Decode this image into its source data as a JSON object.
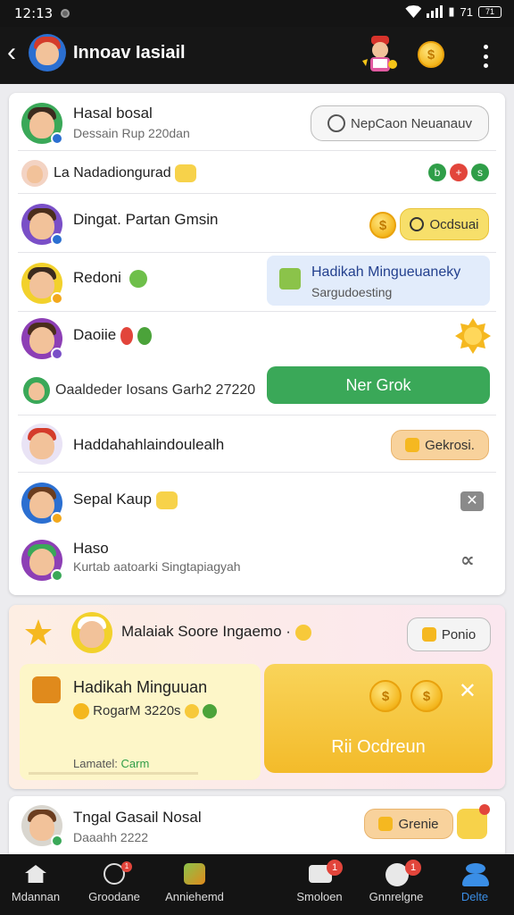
{
  "status": {
    "time": "12:13",
    "battery": "71",
    "signal": "71"
  },
  "header": {
    "title": "Innoav Iasiail"
  },
  "list": [
    {
      "name": "Hasal bosal",
      "sub": "Dessain Rup 220dan",
      "action": "NepCaon Neuanauv"
    },
    {
      "name": "La Nadadiongurad",
      "icons": [
        "b",
        "+",
        "s"
      ]
    },
    {
      "name": "Dingat. Partan Gmsin",
      "action": "Ocdsuai"
    },
    {
      "name": "Redoni",
      "popup_title": "Hadikah Mingueuaneky",
      "popup_sub": "Sargudoesting"
    },
    {
      "name": "Daoiie"
    },
    {
      "name": "Oaaldeder Iosans Garh2 27220",
      "action": "Ner Grok"
    },
    {
      "name": "Haddahahlaindoulealh",
      "action": "Gekrosi."
    },
    {
      "name": "Sepal Kaup"
    },
    {
      "name": "Haso",
      "sub": "Kurtab aatoarki Singtapiagyah"
    }
  ],
  "promo": {
    "title": "Malaiak Soore Ingaemo ·",
    "button": "Ponio",
    "reward_title": "Hadikah Minguuan",
    "reward_sub": "RogarM 3220s",
    "reward_footer_label": "Lamatel:",
    "reward_footer_value": "Carm",
    "claim_label": "Rii Ocdreun"
  },
  "bottom_item": {
    "name": "Tngal Gasail Nosal",
    "sub": "Daaahh 2222",
    "action": "Grenie"
  },
  "nav": [
    {
      "label": "Mdannan",
      "badge": ""
    },
    {
      "label": "Groodane",
      "badge": "1"
    },
    {
      "label": "Anniehemd",
      "badge": ""
    },
    {
      "label": "Smoloen",
      "badge": "1"
    },
    {
      "label": "Gnnrelgne",
      "badge": "1"
    },
    {
      "label": "Delte",
      "badge": ""
    }
  ],
  "colors": {
    "accent_green": "#3aa858",
    "accent_yellow": "#f7d24a",
    "nav_active": "#3a8ee6"
  }
}
